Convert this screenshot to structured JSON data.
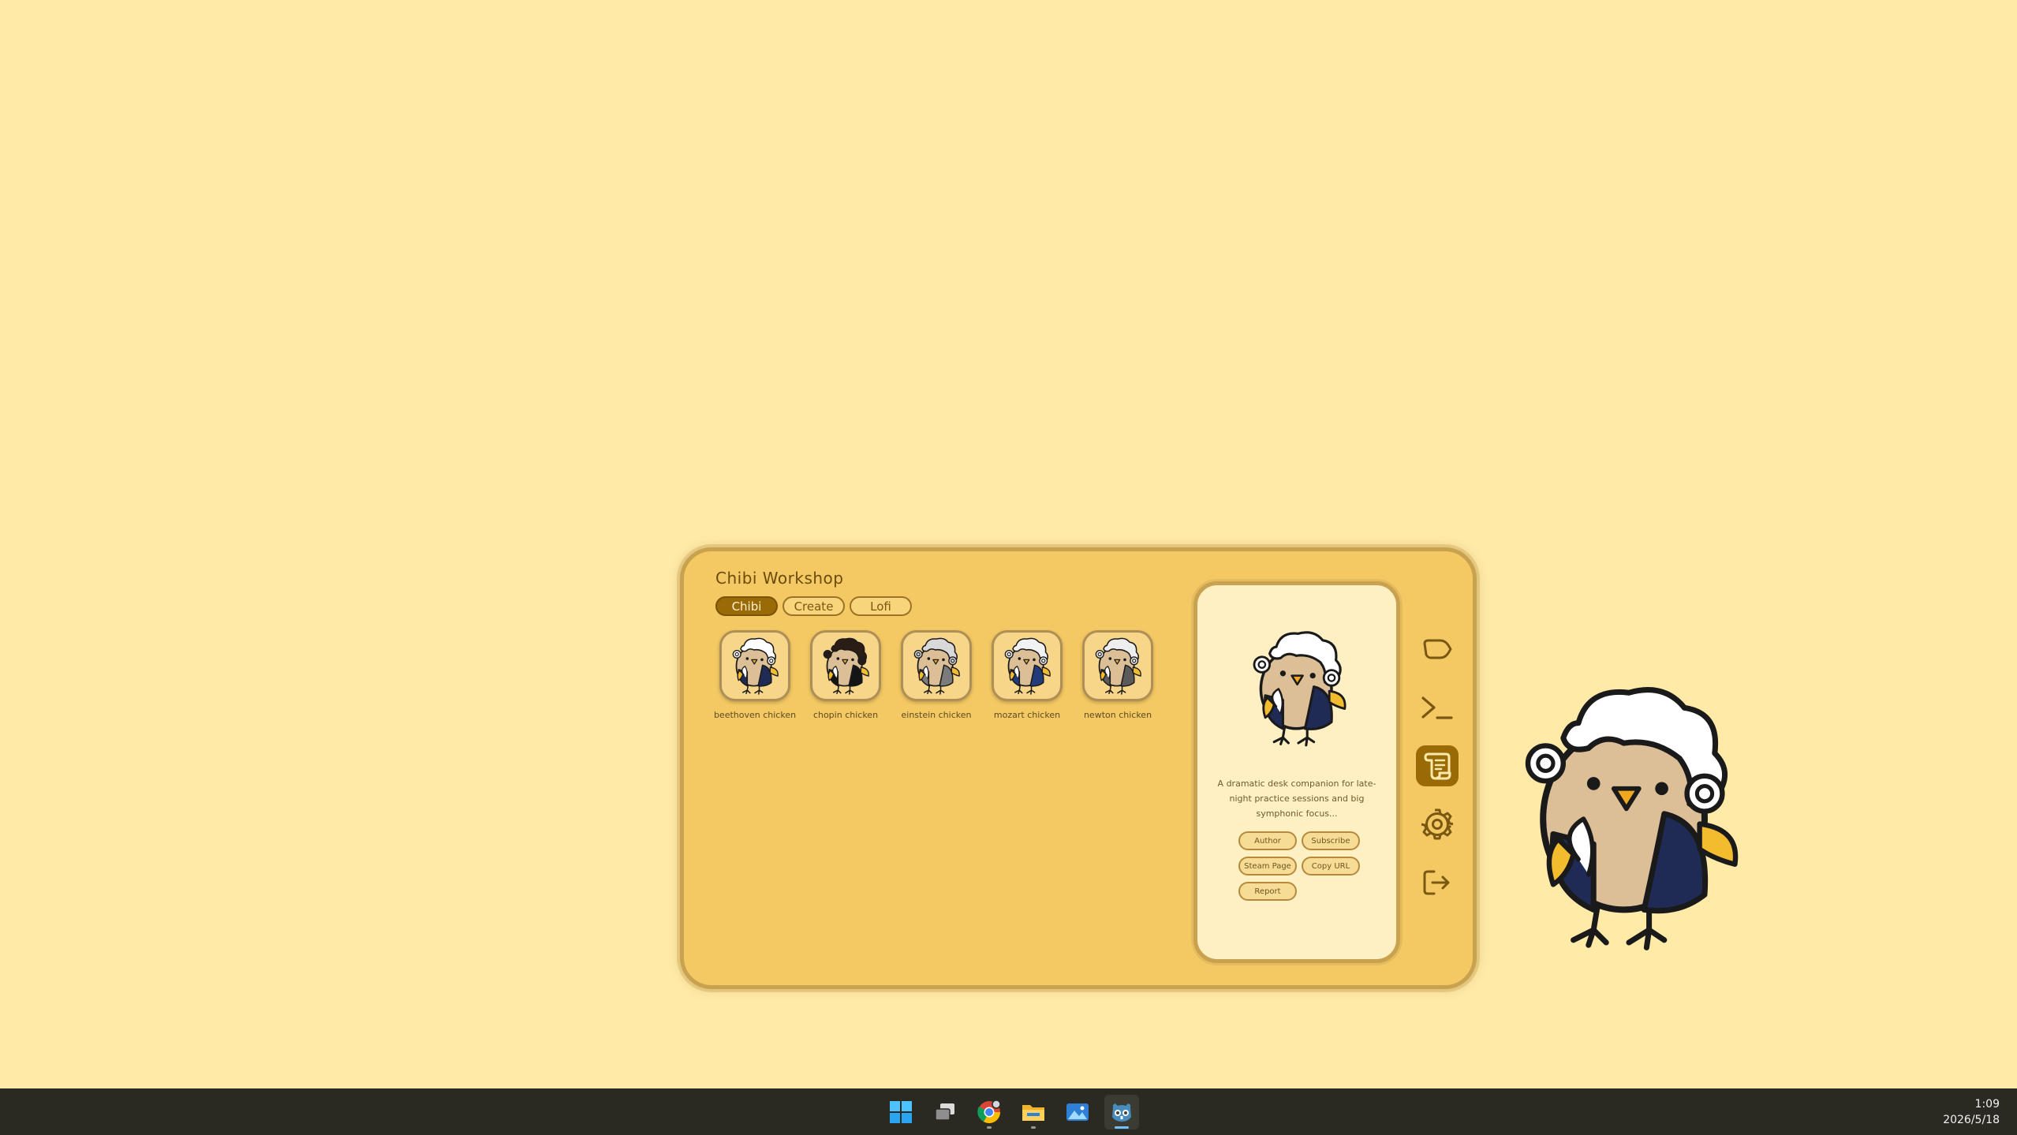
{
  "window": {
    "title": "Chibi Workshop",
    "tabs": [
      {
        "label": "Chibi",
        "active": true
      },
      {
        "label": "Create",
        "active": false
      },
      {
        "label": "Lofi",
        "active": false
      }
    ],
    "items": [
      {
        "label": "beethoven chicken",
        "hair": "#ffffff",
        "coat": "#1f2a55"
      },
      {
        "label": "chopin chicken",
        "hair": "#2a1d16",
        "coat": "#151515"
      },
      {
        "label": "einstein chicken",
        "hair": "#d9d9d9",
        "coat": "#7b7b7b"
      },
      {
        "label": "mozart chicken",
        "hair": "#f2f2f2",
        "coat": "#233b7a"
      },
      {
        "label": "newton chicken",
        "hair": "#eeeeee",
        "coat": "#5a5a5a"
      }
    ],
    "detail": {
      "description": "A dramatic desk companion for late-night practice sessions and big symphonic focus...",
      "buttons": [
        "Author",
        "Subscribe",
        "Steam Page",
        "Copy URL",
        "Report"
      ]
    },
    "sidenav": [
      {
        "icon": "tag-icon",
        "active": false
      },
      {
        "icon": "terminal-icon",
        "active": false
      },
      {
        "icon": "scroll-icon",
        "active": true
      },
      {
        "icon": "gear-icon",
        "active": false
      },
      {
        "icon": "exit-icon",
        "active": false
      }
    ]
  },
  "taskbar": {
    "icons": [
      "windows-start-icon",
      "task-view-icon",
      "chrome-icon",
      "file-explorer-icon",
      "photos-icon",
      "godot-icon"
    ],
    "time": "1:09",
    "date": "2026/5/18"
  },
  "colors": {
    "background": "#FFEAA8",
    "window": "#F4C964",
    "accent": "#9A6A06",
    "taskbar": "#2B2A22"
  }
}
